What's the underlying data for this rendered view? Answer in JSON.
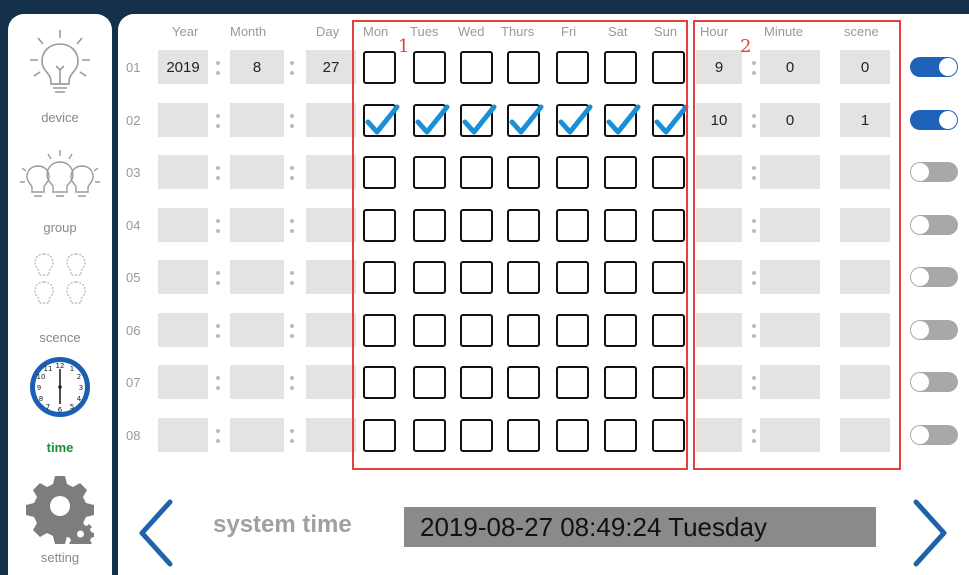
{
  "sidebar": {
    "items": [
      {
        "label": "device",
        "icon": "bulb-icon"
      },
      {
        "label": "group",
        "icon": "bulbs-group-icon"
      },
      {
        "label": "scence",
        "icon": "bulbs-scene-icon"
      },
      {
        "label": "time",
        "icon": "clock-icon",
        "active": true
      },
      {
        "label": "setting",
        "icon": "gear-icon"
      }
    ]
  },
  "headers": {
    "year": "Year",
    "month": "Month",
    "day": "Day",
    "mon": "Mon",
    "tue": "Tues",
    "wed": "Wed",
    "thu": "Thurs",
    "fri": "Fri",
    "sat": "Sat",
    "sun": "Sun",
    "hour": "Hour",
    "minute": "Minute",
    "scene": "scene"
  },
  "annotations": {
    "box1": "1",
    "box2": "2"
  },
  "rows": [
    {
      "no": "01",
      "year": "2019",
      "month": "8",
      "day": "27",
      "days": [
        false,
        false,
        false,
        false,
        false,
        false,
        false
      ],
      "hour": "9",
      "minute": "0",
      "scene": "0",
      "enabled": true
    },
    {
      "no": "02",
      "year": "",
      "month": "",
      "day": "",
      "days": [
        true,
        true,
        true,
        true,
        true,
        true,
        true
      ],
      "hour": "10",
      "minute": "0",
      "scene": "1",
      "enabled": true
    },
    {
      "no": "03",
      "year": "",
      "month": "",
      "day": "",
      "days": [
        false,
        false,
        false,
        false,
        false,
        false,
        false
      ],
      "hour": "",
      "minute": "",
      "scene": "",
      "enabled": false
    },
    {
      "no": "04",
      "year": "",
      "month": "",
      "day": "",
      "days": [
        false,
        false,
        false,
        false,
        false,
        false,
        false
      ],
      "hour": "",
      "minute": "",
      "scene": "",
      "enabled": false
    },
    {
      "no": "05",
      "year": "",
      "month": "",
      "day": "",
      "days": [
        false,
        false,
        false,
        false,
        false,
        false,
        false
      ],
      "hour": "",
      "minute": "",
      "scene": "",
      "enabled": false
    },
    {
      "no": "06",
      "year": "",
      "month": "",
      "day": "",
      "days": [
        false,
        false,
        false,
        false,
        false,
        false,
        false
      ],
      "hour": "",
      "minute": "",
      "scene": "",
      "enabled": false
    },
    {
      "no": "07",
      "year": "",
      "month": "",
      "day": "",
      "days": [
        false,
        false,
        false,
        false,
        false,
        false,
        false
      ],
      "hour": "",
      "minute": "",
      "scene": "",
      "enabled": false
    },
    {
      "no": "08",
      "year": "",
      "month": "",
      "day": "",
      "days": [
        false,
        false,
        false,
        false,
        false,
        false,
        false
      ],
      "hour": "",
      "minute": "",
      "scene": "",
      "enabled": false
    }
  ],
  "footer": {
    "system_time_label": "system time",
    "system_time_value": "2019-08-27 08:49:24 Tuesday",
    "prev_icon": "chevron-left-icon",
    "next_icon": "chevron-right-icon"
  },
  "colors": {
    "accent": "#1e63b8",
    "check": "#1a8fd8",
    "active_nav": "#1f8a3a",
    "annotation": "#e34040",
    "toggle_off": "#a8a8a8",
    "cell_bg": "#e3e3e3"
  }
}
